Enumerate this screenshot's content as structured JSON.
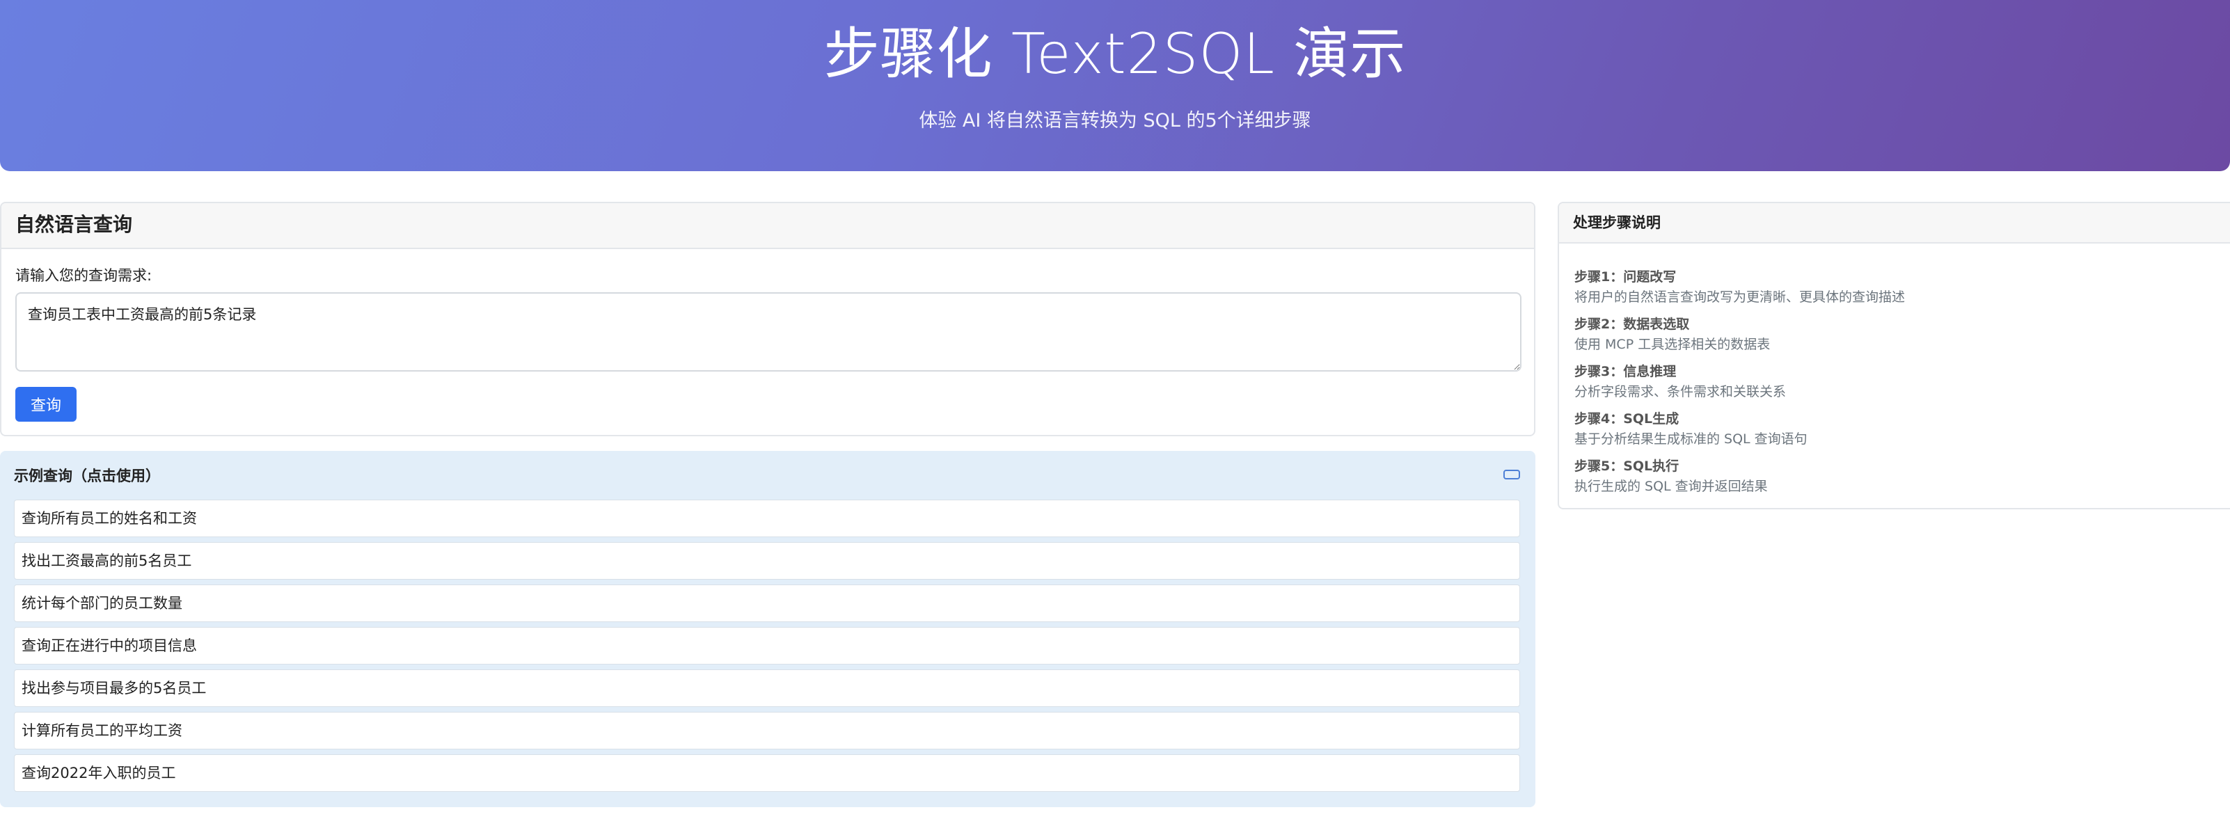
{
  "header": {
    "title": "步骤化 Text2SQL 演示",
    "subtitle": "体验 AI 将自然语言转换为 SQL 的5个详细步骤"
  },
  "query_card": {
    "title": "自然语言查询",
    "label": "请输入您的查询需求:",
    "input_value": "查询员工表中工资最高的前5条记录",
    "button_label": "查询"
  },
  "examples": {
    "title": "示例查询（点击使用）",
    "items": [
      "查询所有员工的姓名和工资",
      "找出工资最高的前5名员工",
      "统计每个部门的员工数量",
      "查询正在进行中的项目信息",
      "找出参与项目最多的5名员工",
      "计算所有员工的平均工资",
      "查询2022年入职的员工"
    ]
  },
  "steps_card": {
    "title": "处理步骤说明",
    "steps": [
      {
        "title": "步骤1：问题改写",
        "desc": "将用户的自然语言查询改写为更清晰、更具体的查询描述"
      },
      {
        "title": "步骤2：数据表选取",
        "desc": "使用 MCP 工具选择相关的数据表"
      },
      {
        "title": "步骤3：信息推理",
        "desc": "分析字段需求、条件需求和关联关系"
      },
      {
        "title": "步骤4：SQL生成",
        "desc": "基于分析结果生成标准的 SQL 查询语句"
      },
      {
        "title": "步骤5：SQL执行",
        "desc": "执行生成的 SQL 查询并返回结果"
      }
    ]
  },
  "colors": {
    "primary_button": "#2f6ff0",
    "gradient_start": "#6a7fe0",
    "gradient_end": "#6c4aa3",
    "examples_bg": "#e2eef9"
  }
}
